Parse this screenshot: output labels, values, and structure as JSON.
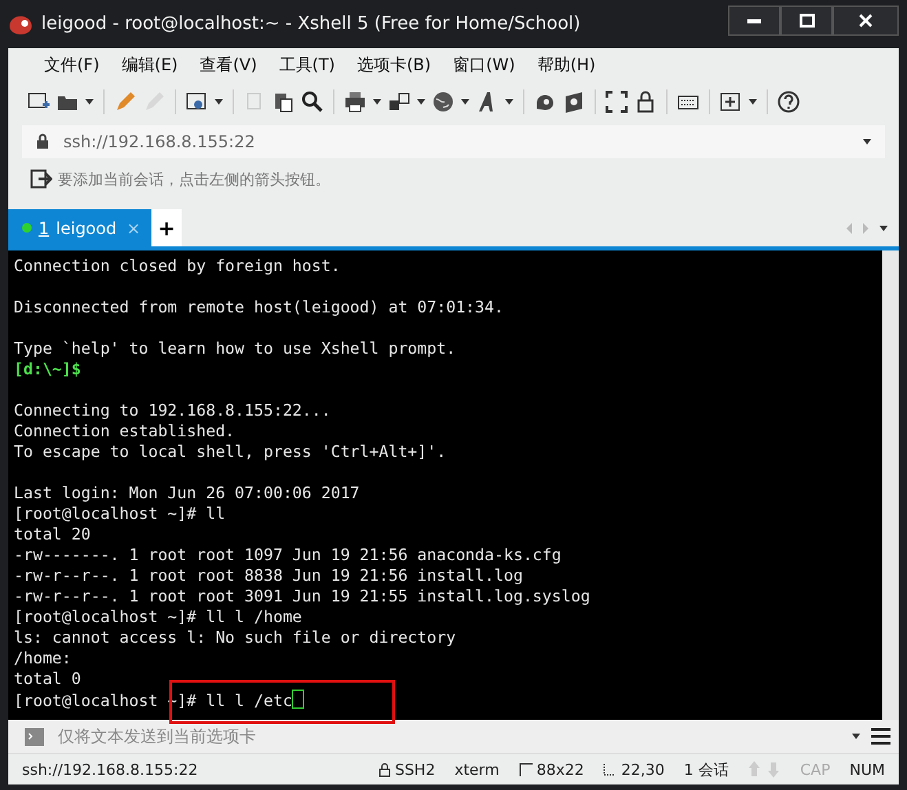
{
  "window": {
    "title": "leigood - root@localhost:~ - Xshell 5 (Free for Home/School)"
  },
  "menu": [
    "文件(F)",
    "编辑(E)",
    "查看(V)",
    "工具(T)",
    "选项卡(B)",
    "窗口(W)",
    "帮助(H)"
  ],
  "address": {
    "value": "ssh://192.168.8.155:22"
  },
  "hint": "要添加当前会话，点击左侧的箭头按钮。",
  "tabs": [
    {
      "number": "1",
      "label": "leigood",
      "selected": true,
      "connected": true,
      "close": "×"
    }
  ],
  "new_tab": "+",
  "terminal": {
    "lines": [
      {
        "text": "Connection closed by foreign host.",
        "kind": "normal"
      },
      {
        "kind": "blank"
      },
      {
        "text": "Disconnected from remote host(leigood) at 07:01:34.",
        "kind": "normal"
      },
      {
        "kind": "blank"
      },
      {
        "text": "Type `help' to learn how to use Xshell prompt.",
        "kind": "normal"
      },
      {
        "text": "[d:\\~]$",
        "kind": "local-prompt"
      },
      {
        "kind": "blank"
      },
      {
        "text": "Connecting to 192.168.8.155:22...",
        "kind": "normal"
      },
      {
        "text": "Connection established.",
        "kind": "normal"
      },
      {
        "text": "To escape to local shell, press 'Ctrl+Alt+]'.",
        "kind": "normal"
      },
      {
        "kind": "blank"
      },
      {
        "text": "Last login: Mon Jun 26 07:00:06 2017",
        "kind": "normal"
      },
      {
        "text": "[root@localhost ~]# ll",
        "kind": "normal"
      },
      {
        "text": "total 20",
        "kind": "normal"
      },
      {
        "text": "-rw-------. 1 root root 1097 Jun 19 21:56 anaconda-ks.cfg",
        "kind": "normal"
      },
      {
        "text": "-rw-r--r--. 1 root root 8838 Jun 19 21:56 install.log",
        "kind": "normal"
      },
      {
        "text": "-rw-r--r--. 1 root root 3091 Jun 19 21:55 install.log.syslog",
        "kind": "normal"
      },
      {
        "text": "[root@localhost ~]# ll l /home",
        "kind": "normal"
      },
      {
        "text": "ls: cannot access l: No such file or directory",
        "kind": "normal"
      },
      {
        "text": "/home:",
        "kind": "normal"
      },
      {
        "text": "total 0",
        "kind": "normal"
      },
      {
        "text": "[root@localhost ~]# ll l /etc",
        "kind": "cursor"
      }
    ]
  },
  "compose": {
    "placeholder": "仅将文本发送到当前选项卡"
  },
  "status_bar": {
    "address": "ssh://192.168.8.155:22",
    "protocol": "SSH2",
    "terminal": "xterm",
    "size": "88x22",
    "cursor": "22,30",
    "sessions": "1 会话",
    "indicators": [
      {
        "label": "CAP",
        "on": false
      },
      {
        "label": "NUM",
        "on": true
      }
    ]
  }
}
